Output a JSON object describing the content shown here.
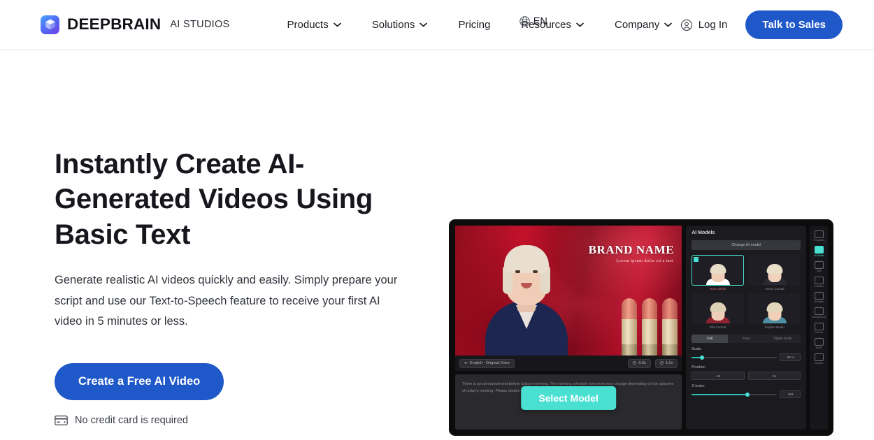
{
  "header": {
    "logo_icon": "cube-logo-icon",
    "brand_name": "DEEPBRAIN",
    "brand_sub": "AI STUDIOS",
    "nav": [
      {
        "label": "Products",
        "has_dropdown": true
      },
      {
        "label": "Solutions",
        "has_dropdown": true
      },
      {
        "label": "Pricing",
        "has_dropdown": false
      },
      {
        "label": "Resources",
        "has_dropdown": true
      },
      {
        "label": "Company",
        "has_dropdown": true
      }
    ],
    "language": {
      "icon": "globe-icon",
      "label": "EN"
    },
    "login": {
      "icon": "user-circle-icon",
      "label": "Log In"
    },
    "cta": {
      "label": "Talk to Sales",
      "color": "#1f58c9"
    }
  },
  "hero": {
    "title": "Instantly Create AI-Generated Videos Using Basic Text",
    "subtitle": "Generate realistic AI videos quickly and easily. Simply prepare your script and use our Text-to-Speech feature to receive your first AI video in 5 minutes or less.",
    "cta_label": "Create a Free AI Video",
    "cta_color": "#1f58c9",
    "note_icon": "credit-card-icon",
    "note": "No credit card is required"
  },
  "app_mock": {
    "stage": {
      "brand_title": "BRAND NAME",
      "brand_tagline": "Lorem ipsum dolor sit a met",
      "lipstick_colors": [
        "#e2826f",
        "#e0826e",
        "#d9766a",
        "#e88f76"
      ]
    },
    "toolbar": {
      "voice_icon": "waveform-icon",
      "voice_label": "English - Original Voice",
      "duration_icon": "clock-icon",
      "duration": "0.0s",
      "speed_icon": "gauge-icon",
      "speed": "1.0x"
    },
    "script_text": "There is an announcement before today's meeting. The morning schedule tomorrow may change depending on the outcome of today's meeting. Please double-check your schedule after the meeting.",
    "select_model_button": {
      "label": "Select Model",
      "color": "#49e0d2"
    },
    "panel": {
      "title": "AI Models",
      "change_button": "Change AI model",
      "models": [
        {
          "label": "Hana White",
          "selected": true,
          "hair": "#e6dcc8",
          "skin": "#f0cdb6",
          "outfit": "#ffffff"
        },
        {
          "label": "Jenny Casual",
          "selected": false,
          "hair": "#e9dfc9",
          "skin": "#f2d2bb",
          "outfit": "#2a2a32"
        },
        {
          "label": "Ella Formal",
          "selected": false,
          "hair": "#ddd0b2",
          "skin": "#f0cdb6",
          "outfit": "#8d2230"
        },
        {
          "label": "Sophie Studio",
          "selected": false,
          "hair": "#e4d7bb",
          "skin": "#f1d0b8",
          "outfit": "#4f8fa3"
        }
      ],
      "view_tabs": [
        {
          "label": "Full",
          "active": true
        },
        {
          "label": "Face",
          "active": false
        },
        {
          "label": "Upper body",
          "active": false
        }
      ],
      "scale": {
        "label": "Scale",
        "value": "46 %",
        "fill_pct": 12
      },
      "position": {
        "label": "Position",
        "x": "-24",
        "y": "41"
      },
      "zindex": {
        "label": "Z-index",
        "value": "404",
        "fill_pct": 66
      }
    },
    "rail": [
      {
        "label": "Templates",
        "icon": "templates-icon",
        "active": false
      },
      {
        "label": "AI Model",
        "icon": "ai-model-icon",
        "active": true
      },
      {
        "label": "Text",
        "icon": "text-icon",
        "active": false
      },
      {
        "label": "Subtitles",
        "icon": "subtitles-icon",
        "active": false
      },
      {
        "label": "Template",
        "icon": "layout-icon",
        "active": false
      },
      {
        "label": "Background",
        "icon": "background-icon",
        "active": false
      },
      {
        "label": "Frames",
        "icon": "frames-icon",
        "active": false
      },
      {
        "label": "Audio",
        "icon": "audio-icon",
        "active": false
      },
      {
        "label": "Shapes",
        "icon": "shapes-icon",
        "active": false
      }
    ]
  }
}
